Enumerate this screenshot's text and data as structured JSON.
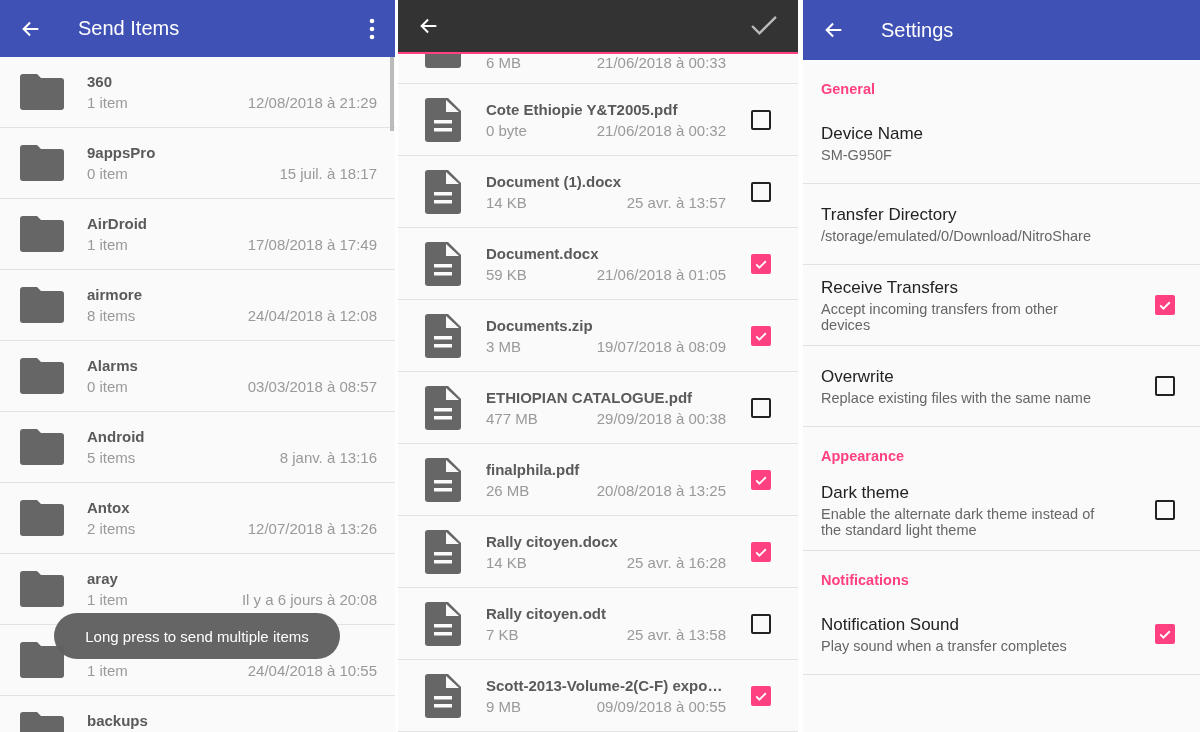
{
  "send_items": {
    "title": "Send Items",
    "folders": [
      {
        "kind": "full",
        "name": "360",
        "count": "1 item",
        "date": "12/08/2018 à 21:29"
      },
      {
        "kind": "full",
        "name": "9appsPro",
        "count": "0 item",
        "date": "15 juil. à 18:17"
      },
      {
        "kind": "full",
        "name": "AirDroid",
        "count": "1 item",
        "date": "17/08/2018 à 17:49"
      },
      {
        "kind": "full",
        "name": "airmore",
        "count": "8 items",
        "date": "24/04/2018 à 12:08"
      },
      {
        "kind": "full",
        "name": "Alarms",
        "count": "0 item",
        "date": "03/03/2018 à 08:57"
      },
      {
        "kind": "full",
        "name": "Android",
        "count": "5 items",
        "date": "8 janv. à 13:16"
      },
      {
        "kind": "full",
        "name": "Antox",
        "count": "2 items",
        "date": "12/07/2018 à 13:26"
      },
      {
        "kind": "full",
        "name": "aray",
        "count": "1 item",
        "date": "Il y a 6 jours à 20:08"
      },
      {
        "kind": "covered",
        "count": "1 item",
        "date": "24/04/2018 à 10:55"
      },
      {
        "kind": "cut",
        "name": "backups"
      }
    ],
    "toast": "Long press to send multiple items"
  },
  "file_picker": {
    "files": [
      {
        "kind": "cut",
        "size": "6 MB",
        "date": "21/06/2018 à 00:33"
      },
      {
        "kind": "full",
        "name": "Cote Ethiopie Y&T2005.pdf",
        "size": "0 byte",
        "date": "21/06/2018 à 00:32",
        "checked": false
      },
      {
        "kind": "full",
        "name": "Document (1).docx",
        "size": "14 KB",
        "date": "25 avr. à 13:57",
        "checked": false
      },
      {
        "kind": "full",
        "name": "Document.docx",
        "size": "59 KB",
        "date": "21/06/2018 à 01:05",
        "checked": true
      },
      {
        "kind": "full",
        "name": "Documents.zip",
        "size": "3 MB",
        "date": "19/07/2018 à 08:09",
        "checked": true
      },
      {
        "kind": "full",
        "name": "ETHIOPIAN CATALOGUE.pdf",
        "size": "477 MB",
        "date": "29/09/2018 à 00:38",
        "checked": false
      },
      {
        "kind": "full",
        "name": "finalphila.pdf",
        "size": "26 MB",
        "date": "20/08/2018 à 13:25",
        "checked": true
      },
      {
        "kind": "full",
        "name": "Rally citoyen.docx",
        "size": "14 KB",
        "date": "25 avr. à 16:28",
        "checked": true
      },
      {
        "kind": "full",
        "name": "Rally citoyen.odt",
        "size": "7 KB",
        "date": "25 avr. à 13:58",
        "checked": false
      },
      {
        "kind": "full",
        "name": "Scott-2013-Volume-2(C-F) expo…",
        "size": "9 MB",
        "date": "09/09/2018 à 00:55",
        "checked": true
      }
    ]
  },
  "settings": {
    "title": "Settings",
    "sections": [
      {
        "heading": "General",
        "items": [
          {
            "kind": "text",
            "title": "Device Name",
            "summary": "SM-G950F"
          },
          {
            "kind": "text",
            "title": "Transfer Directory",
            "summary": "/storage/emulated/0/Download/NitroShare"
          },
          {
            "kind": "check",
            "title": "Receive Transfers",
            "summary": "Accept incoming transfers from other devices",
            "checked": true
          },
          {
            "kind": "check",
            "title": "Overwrite",
            "summary": "Replace existing files with the same name",
            "checked": false
          }
        ]
      },
      {
        "heading": "Appearance",
        "items": [
          {
            "kind": "check",
            "title": "Dark theme",
            "summary": "Enable the alternate dark theme instead of the standard light theme",
            "checked": false
          }
        ]
      },
      {
        "heading": "Notifications",
        "items": [
          {
            "kind": "check",
            "title": "Notification Sound",
            "summary": "Play sound when a transfer completes",
            "checked": true
          }
        ]
      }
    ]
  }
}
